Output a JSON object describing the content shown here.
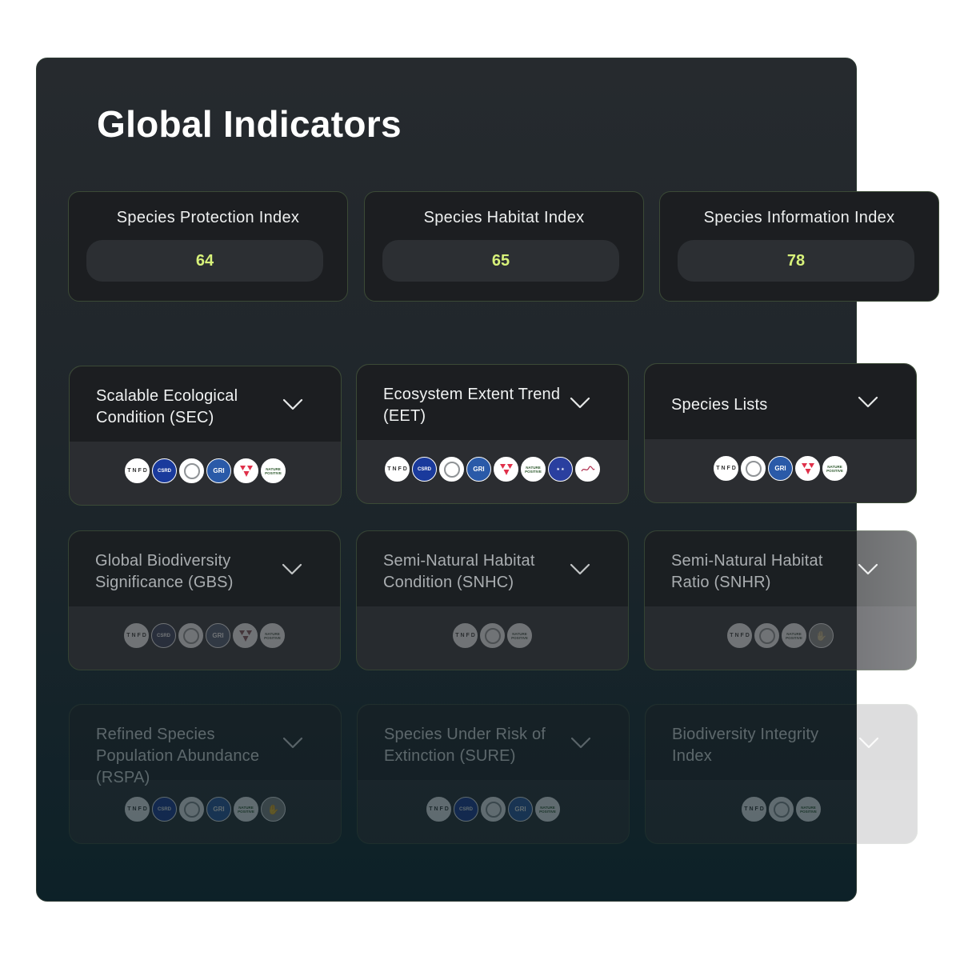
{
  "title": "Global Indicators",
  "indices": [
    {
      "label": "Species Protection Index",
      "value": "64"
    },
    {
      "label": "Species Habitat Index",
      "value": "65"
    },
    {
      "label": "Species Information Index",
      "value": "78"
    }
  ],
  "indicators": [
    {
      "name": "Scalable Ecological Condition (SEC)",
      "badges": [
        "tnfd-badge",
        "csrd-badge",
        "ring-badge",
        "gri-badge",
        "red-badge",
        "nature-badge"
      ]
    },
    {
      "name": "Ecosystem Extent Trend (EET)",
      "badges": [
        "tnfd-badge",
        "csrd-badge",
        "ring-badge",
        "gri-badge",
        "red-badge",
        "nature-badge",
        "eu-badge",
        "signature-badge"
      ]
    },
    {
      "name": "Species Lists",
      "badges": [
        "tnfd-badge",
        "ring-badge",
        "gri-badge",
        "red-badge",
        "nature-badge"
      ]
    },
    {
      "name": "Global Biodiversity Significance (GBS)",
      "badges": [
        "tnfd-badge",
        "csrd-badge",
        "ring-badge",
        "gri-badge",
        "red-badge",
        "nature-badge"
      ]
    },
    {
      "name": "Semi-Natural Habitat Condition (SNHC)",
      "badges": [
        "tnfd-badge",
        "ring-badge",
        "nature-badge"
      ]
    },
    {
      "name": "Semi-Natural Habitat Ratio (SNHR)",
      "badges": [
        "tnfd-badge",
        "ring-badge",
        "nature-badge",
        "hand-badge"
      ]
    },
    {
      "name": "Refined Species Population Abundance (RSPA)",
      "badges": [
        "tnfd-badge",
        "csrd-badge",
        "ring-badge",
        "gri-badge",
        "nature-badge",
        "hand-badge"
      ]
    },
    {
      "name": "Species Under Risk of Extinction (SURE)",
      "badges": [
        "tnfd-badge",
        "csrd-badge",
        "ring-badge",
        "gri-badge",
        "nature-badge"
      ]
    },
    {
      "name": "Biodiversity Integrity Index",
      "badges": [
        "tnfd-badge",
        "ring-badge",
        "nature-badge"
      ]
    }
  ],
  "badge_text": {
    "tnfd": "T N F D",
    "csrd": "CSRD",
    "gri": "GRI",
    "nature": "NATURE POSITIVE",
    "eu": "★ ★"
  },
  "colors": {
    "index_value": "#d8f27a",
    "card_border": "#3b4a36",
    "panel_top": "#262a2e",
    "panel_bottom": "#0d2128"
  }
}
